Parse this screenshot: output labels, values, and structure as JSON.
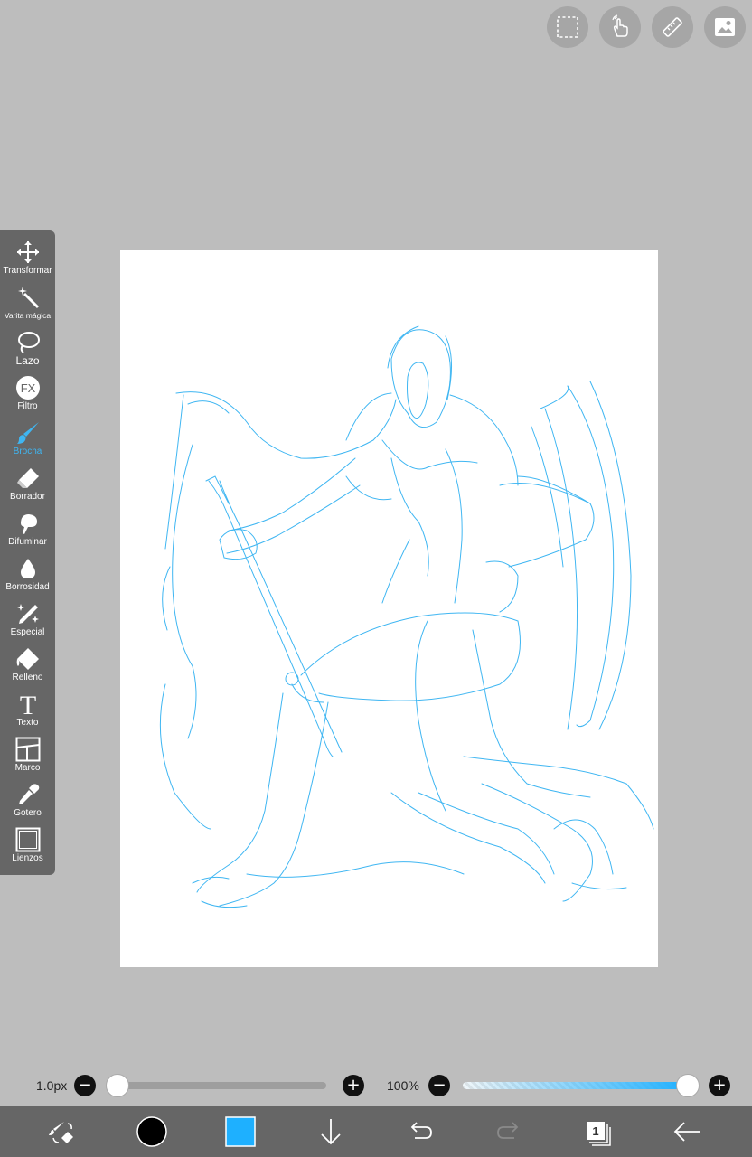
{
  "top_buttons": [
    {
      "name": "selection-icon"
    },
    {
      "name": "hand-gesture-icon"
    },
    {
      "name": "ruler-icon"
    },
    {
      "name": "image-icon"
    }
  ],
  "toolbar": {
    "items": [
      {
        "label": "Transformar",
        "icon": "move-arrows-icon"
      },
      {
        "label": "Varita mágica",
        "icon": "magic-wand-icon"
      },
      {
        "label": "Lazo",
        "icon": "lasso-icon"
      },
      {
        "label": "Filtro",
        "icon": "fx-icon"
      },
      {
        "label": "Brocha",
        "icon": "brush-icon",
        "active": true
      },
      {
        "label": "Borrador",
        "icon": "eraser-icon"
      },
      {
        "label": "Difuminar",
        "icon": "smudge-icon"
      },
      {
        "label": "Borrosidad",
        "icon": "blur-drop-icon"
      },
      {
        "label": "Especial",
        "icon": "sparkle-pen-icon"
      },
      {
        "label": "Relleno",
        "icon": "fill-bucket-icon"
      },
      {
        "label": "Texto",
        "icon": "text-icon"
      },
      {
        "label": "Marco",
        "icon": "frame-icon"
      },
      {
        "label": "Gotero",
        "icon": "eyedropper-icon"
      },
      {
        "label": "Lienzos",
        "icon": "canvas-icon"
      }
    ]
  },
  "brush_size": {
    "value": "1.0px",
    "minus": "−",
    "plus": "+",
    "level": 0.0
  },
  "opacity": {
    "value": "100%",
    "minus": "−",
    "plus": "+",
    "level": 1.0
  },
  "colors": {
    "accent": "#3fb6f2",
    "primary_color": "#000000",
    "layer_color": "#1eb0ff",
    "sketch": "#3fb6f2"
  },
  "layers": {
    "count": "1"
  }
}
